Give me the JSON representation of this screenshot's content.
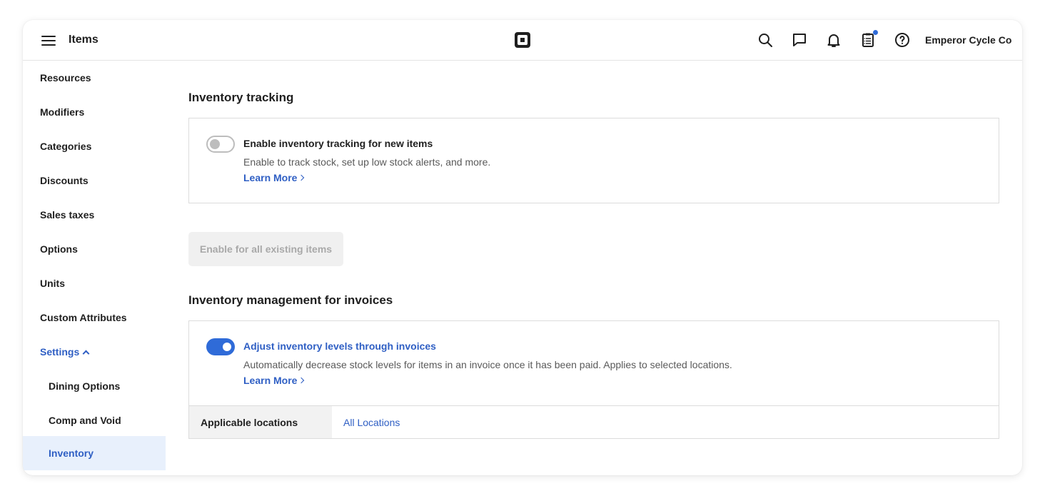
{
  "header": {
    "title": "Items",
    "account_name": "Emperor Cycle Co",
    "icons": [
      "menu-icon",
      "square-logo-icon",
      "search-icon",
      "messages-icon",
      "bell-icon",
      "clipboard-icon",
      "help-icon"
    ],
    "notification_dot_color": "#2f6bd8"
  },
  "sidebar": {
    "items": [
      {
        "label": "Resources"
      },
      {
        "label": "Modifiers"
      },
      {
        "label": "Categories"
      },
      {
        "label": "Discounts"
      },
      {
        "label": "Sales taxes"
      },
      {
        "label": "Options"
      },
      {
        "label": "Units"
      },
      {
        "label": "Custom Attributes"
      },
      {
        "label": "Settings"
      }
    ],
    "sub_items": [
      {
        "label": "Dining Options"
      },
      {
        "label": "Comp and Void"
      },
      {
        "label": "Inventory"
      }
    ]
  },
  "inventory_tracking": {
    "title": "Inventory tracking",
    "toggle_state": "off",
    "option_title": "Enable inventory tracking for new items",
    "option_desc": "Enable to track stock, set up low stock alerts, and more.",
    "learn_more": "Learn More",
    "enable_all_button": "Enable for all existing items"
  },
  "invoice_management": {
    "title": "Inventory management for invoices",
    "toggle_state": "on",
    "option_title": "Adjust inventory levels through invoices",
    "option_desc": "Automatically decrease stock levels for items in an invoice once it has been paid. Applies to selected locations.",
    "learn_more": "Learn More",
    "locations_label": "Applicable locations",
    "locations_value": "All Locations"
  },
  "colors": {
    "accent": "#2f6bd8",
    "link": "#2f5fc4",
    "active_bg": "#e8f0fc"
  }
}
